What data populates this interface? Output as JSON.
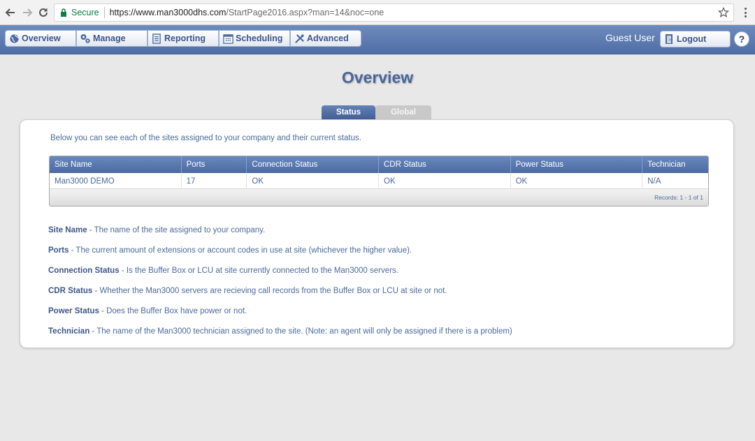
{
  "browser": {
    "secure_label": "Secure",
    "url_host": "https://www.man3000dhs.com",
    "url_path": "/StartPage2016.aspx?man=14&noc=one"
  },
  "menu": {
    "items": [
      {
        "label": "Overview",
        "icon": "globe-icon"
      },
      {
        "label": "Manage",
        "icon": "gears-icon"
      },
      {
        "label": "Reporting",
        "icon": "report-icon"
      },
      {
        "label": "Scheduling",
        "icon": "calendar-icon"
      },
      {
        "label": "Advanced",
        "icon": "tools-icon"
      }
    ],
    "user_label": "Guest User",
    "logout_label": "Logout",
    "help_label": "?"
  },
  "page": {
    "title": "Overview",
    "tabs": [
      {
        "label": "Status",
        "active": true
      },
      {
        "label": "Global",
        "active": false
      }
    ],
    "intro": "Below you can see each of the sites assigned to your company and their current status."
  },
  "table": {
    "columns": [
      "Site Name",
      "Ports",
      "Connection Status",
      "CDR Status",
      "Power Status",
      "Technician"
    ],
    "rows": [
      [
        "Man3000 DEMO",
        "17",
        "OK",
        "OK",
        "OK",
        "N/A"
      ]
    ],
    "records": "Records: 1 - 1 of 1"
  },
  "definitions": [
    {
      "term": "Site Name",
      "text": " - The name of the site assigned to your company."
    },
    {
      "term": "Ports",
      "text": " - The current amount of extensions or account codes in use at site (whichever the higher value)."
    },
    {
      "term": "Connection Status",
      "text": " - Is the Buffer Box or LCU at site currently connected to the Man3000 servers."
    },
    {
      "term": "CDR Status",
      "text": " - Whether the Man3000 servers are recieving call records from the Buffer Box or LCU at site or not."
    },
    {
      "term": "Power Status",
      "text": " - Does the Buffer Box have power or not."
    },
    {
      "term": "Technician",
      "text": " - The name of the Man3000 technician assigned to the site. (Note: an agent will only be assigned if there is a problem)"
    }
  ],
  "colors": {
    "accent": "#4a6598",
    "text": "#4b6a9b",
    "secure": "#0b8043"
  }
}
